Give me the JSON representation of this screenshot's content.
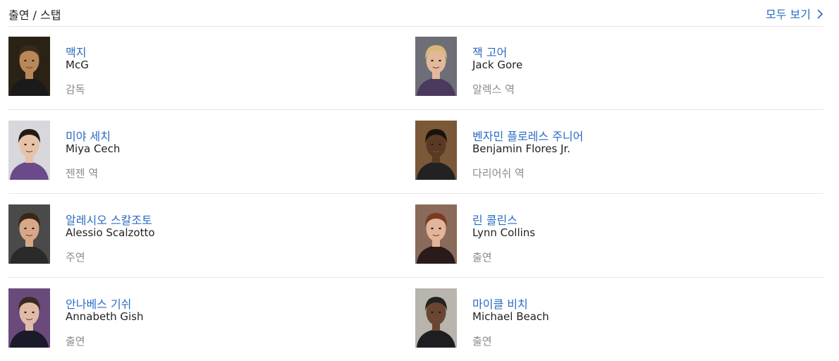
{
  "header": {
    "title": "출연 / 스탭",
    "see_all": "모두 보기"
  },
  "people": [
    {
      "name_ko": "맥지",
      "name_en": "McG",
      "role": "감독",
      "tones": {
        "bg": "#2b2216",
        "skin": "#b88858",
        "hair": "#3a2a18",
        "cloth": "#1a1a1a"
      }
    },
    {
      "name_ko": "잭 고어",
      "name_en": "Jack Gore",
      "role": "알렉스 역",
      "tones": {
        "bg": "#6e6e78",
        "skin": "#e2b99a",
        "hair": "#d8b878",
        "cloth": "#4a3a5e"
      }
    },
    {
      "name_ko": "미야 세치",
      "name_en": "Miya Cech",
      "role": "젠젠 역",
      "tones": {
        "bg": "#d7d7dc",
        "skin": "#e6c2a6",
        "hair": "#231a16",
        "cloth": "#6a4a8a"
      }
    },
    {
      "name_ko": "벤자민 플로레스 주니어",
      "name_en": "Benjamin Flores Jr.",
      "role": "다리어쉬 역",
      "tones": {
        "bg": "#7a5838",
        "skin": "#5a3a24",
        "hair": "#1a120c",
        "cloth": "#222222"
      }
    },
    {
      "name_ko": "알레시오 스칼조토",
      "name_en": "Alessio Scalzotto",
      "role": "주연",
      "tones": {
        "bg": "#4a4a4a",
        "skin": "#d6a888",
        "hair": "#3a2618",
        "cloth": "#2a2a2a"
      }
    },
    {
      "name_ko": "린 콜린스",
      "name_en": "Lynn Collins",
      "role": "출연",
      "tones": {
        "bg": "#8a6a5a",
        "skin": "#e2b49a",
        "hair": "#7a3a22",
        "cloth": "#2a1a1a"
      }
    },
    {
      "name_ko": "안나베스 기쉬",
      "name_en": "Annabeth Gish",
      "role": "출연",
      "tones": {
        "bg": "#6a4a7a",
        "skin": "#e0bca8",
        "hair": "#3a2a24",
        "cloth": "#1a1a2a"
      }
    },
    {
      "name_ko": "마이클 비치",
      "name_en": "Michael Beach",
      "role": "출연",
      "tones": {
        "bg": "#b8b4ae",
        "skin": "#6a4630",
        "hair": "#222222",
        "cloth": "#1e1e22"
      }
    }
  ]
}
